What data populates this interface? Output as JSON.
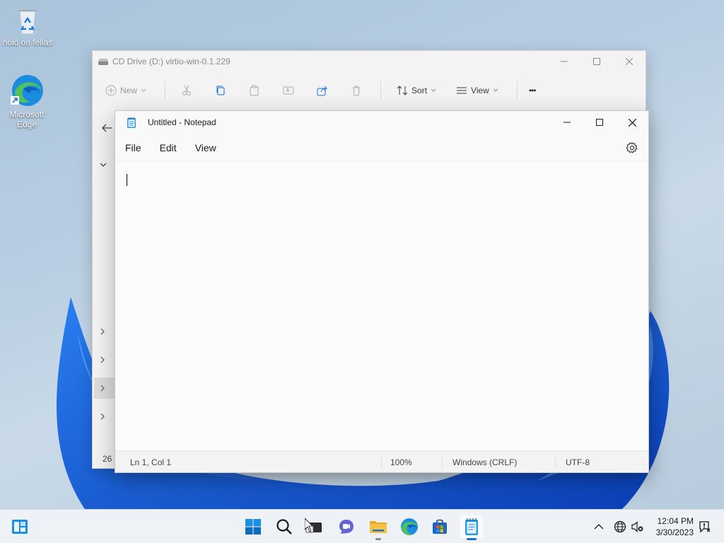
{
  "desktop": {
    "icons": [
      {
        "label": "hold on fellas"
      },
      {
        "label": "Microsoft Edge"
      }
    ]
  },
  "explorer": {
    "title": "CD Drive (D:) virtio-win-0.1.229",
    "toolbar": {
      "new_label": "New",
      "sort_label": "Sort",
      "view_label": "View",
      "more_label": "•••"
    },
    "status_text": "26 i"
  },
  "notepad": {
    "title": "Untitled - Notepad",
    "menu": {
      "file": "File",
      "edit": "Edit",
      "view": "View"
    },
    "content": "",
    "status": {
      "position": "Ln 1, Col 1",
      "zoom": "100%",
      "line_ending": "Windows (CRLF)",
      "encoding": "UTF-8"
    }
  },
  "taskbar": {
    "clock_time": "12:04 PM",
    "clock_date": "3/30/2023"
  },
  "colors": {
    "accent": "#1a6fd3",
    "win_blue": "#0f6cbd",
    "folder_yellow": "#f5c342"
  }
}
